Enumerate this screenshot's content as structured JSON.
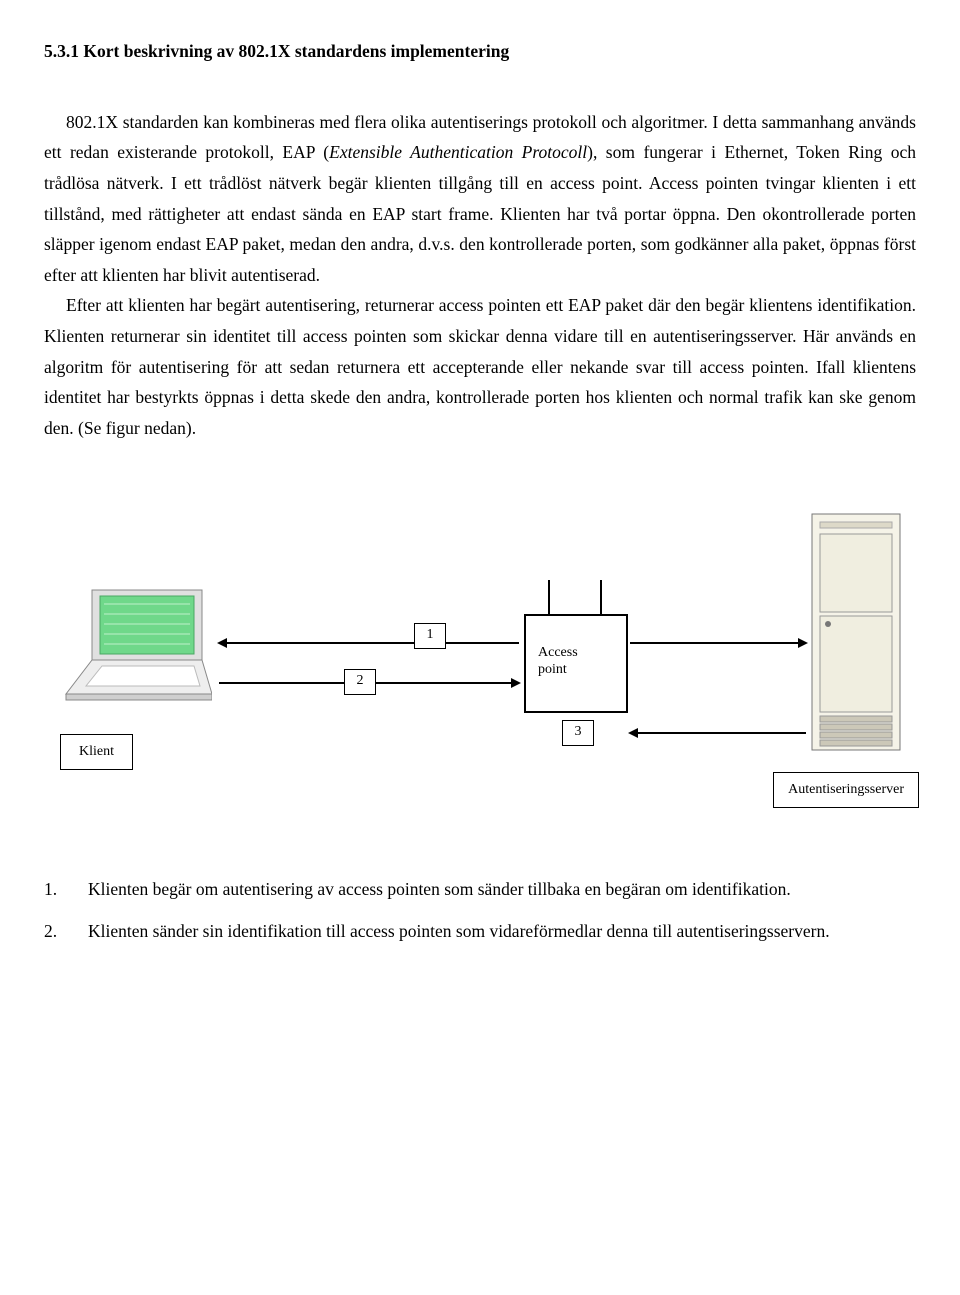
{
  "heading": "5.3.1 Kort beskrivning av 802.1X standardens implementering",
  "p1a": "802.1X standarden kan kombineras med flera olika autentiserings protokoll och algoritmer. I detta sammanhang används ett redan existerande protokoll, EAP (",
  "p1italic": "Extensible Authentication Protocoll",
  "p1b": "), som fungerar i Ethernet, Token Ring och trådlösa nätverk. I ett trådlöst nätverk begär klienten tillgång till en access point. Access pointen tvingar klienten i ett tillstånd, med rättigheter att endast sända en EAP start frame. Klienten har två portar öppna. Den okontrollerade porten släpper igenom endast EAP paket, medan den andra, d.v.s. den kontrollerade porten, som godkänner alla paket, öppnas först efter att klienten har blivit autentiserad.",
  "p2": "Efter att klienten har begärt autentisering, returnerar access pointen ett EAP paket där den begär klientens identifikation. Klienten returnerar sin identitet till access pointen som skickar denna vidare till en autentiseringsserver. Här används en algoritm för autentisering för att sedan returnera ett accepterande eller nekande svar till access pointen. Ifall klientens identitet har bestyrkts öppnas i detta skede den andra, kontrollerade porten hos klienten och normal trafik kan ske genom den. (Se figur nedan).",
  "diagram": {
    "klient": "Klient",
    "num1": "1",
    "num2": "2",
    "num3": "3",
    "ap1": "Access",
    "ap2": "point",
    "auth": "Autentiseringsserver"
  },
  "steps": [
    "Klienten begär om autentisering av access pointen som sänder tillbaka en begäran om identifikation.",
    "Klienten sänder sin identifikation till access pointen som vidareförmedlar denna till autentiseringsservern."
  ]
}
